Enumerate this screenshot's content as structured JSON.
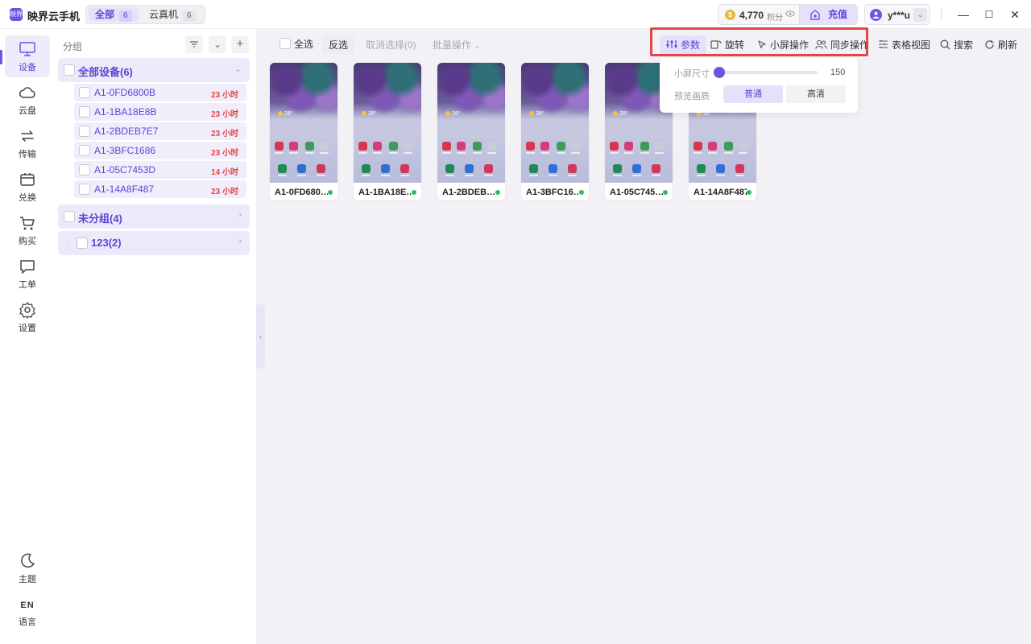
{
  "app": {
    "title": "映界云手机",
    "logo_text": "映界"
  },
  "top_tabs": [
    {
      "label": "全部",
      "count": "6",
      "active": true
    },
    {
      "label": "云真机",
      "count": "6",
      "active": false
    }
  ],
  "account": {
    "points_value": "4,770",
    "points_unit": "积分",
    "recharge_label": "充值",
    "username": "y***u"
  },
  "window_controls": {
    "minimize": "—",
    "maximize": "☐",
    "close": "✕"
  },
  "left_nav": [
    {
      "label": "设备",
      "icon": "monitor-icon",
      "active": true
    },
    {
      "label": "云盘",
      "icon": "cloud-icon"
    },
    {
      "label": "传输",
      "icon": "transfer-icon"
    },
    {
      "label": "兑换",
      "icon": "redeem-icon"
    },
    {
      "label": "购买",
      "icon": "cart-icon"
    },
    {
      "label": "工单",
      "icon": "ticket-icon"
    },
    {
      "label": "设置",
      "icon": "gear-icon"
    }
  ],
  "left_nav_bottom": {
    "theme_label": "主题",
    "lang_code": "EN",
    "lang_label": "语言"
  },
  "group_panel": {
    "title": "分组",
    "groups": [
      {
        "label": "全部设备(6)",
        "expanded": true
      },
      {
        "label": "未分组(4)",
        "expanded": false
      },
      {
        "label": "123(2)",
        "expanded": false
      }
    ],
    "devices": [
      {
        "name": "A1-0FD6800B",
        "time": "23 小时"
      },
      {
        "name": "A1-1BA18E8B",
        "time": "23 小时"
      },
      {
        "name": "A1-2BDEB7E7",
        "time": "23 小时"
      },
      {
        "name": "A1-3BFC1686",
        "time": "23 小时"
      },
      {
        "name": "A1-05C7453D",
        "time": "14 小时"
      },
      {
        "name": "A1-14A8F487",
        "time": "23 小时"
      }
    ]
  },
  "toolbar": {
    "select_all": "全选",
    "invert": "反选",
    "deselect": "取消选择(0)",
    "batch": "批量操作",
    "params": "参数",
    "rotate": "旋转",
    "small_screen_op": "小屏操作",
    "sync_op": "同步操作",
    "table_view": "表格视图",
    "search": "搜索",
    "refresh": "刷新"
  },
  "params_popover": {
    "size_label": "小屏尺寸",
    "size_value": "150",
    "quality_label": "预览画质",
    "quality_normal": "普通",
    "quality_hd": "高清"
  },
  "cards": [
    {
      "name": "A1-0FD680…",
      "temp": "28°"
    },
    {
      "name": "A1-1BA18E…",
      "temp": "28°"
    },
    {
      "name": "A1-2BDEB…",
      "temp": "28°"
    },
    {
      "name": "A1-3BFC16…",
      "temp": "28°"
    },
    {
      "name": "A1-05C745…",
      "temp": "28°"
    },
    {
      "name": "A1-14A8F487",
      "temp": "32°"
    }
  ],
  "colors": {
    "accent": "#6e55e0",
    "highlight": "#e04848",
    "online": "#2fbf5a",
    "time_red": "#e54545"
  }
}
